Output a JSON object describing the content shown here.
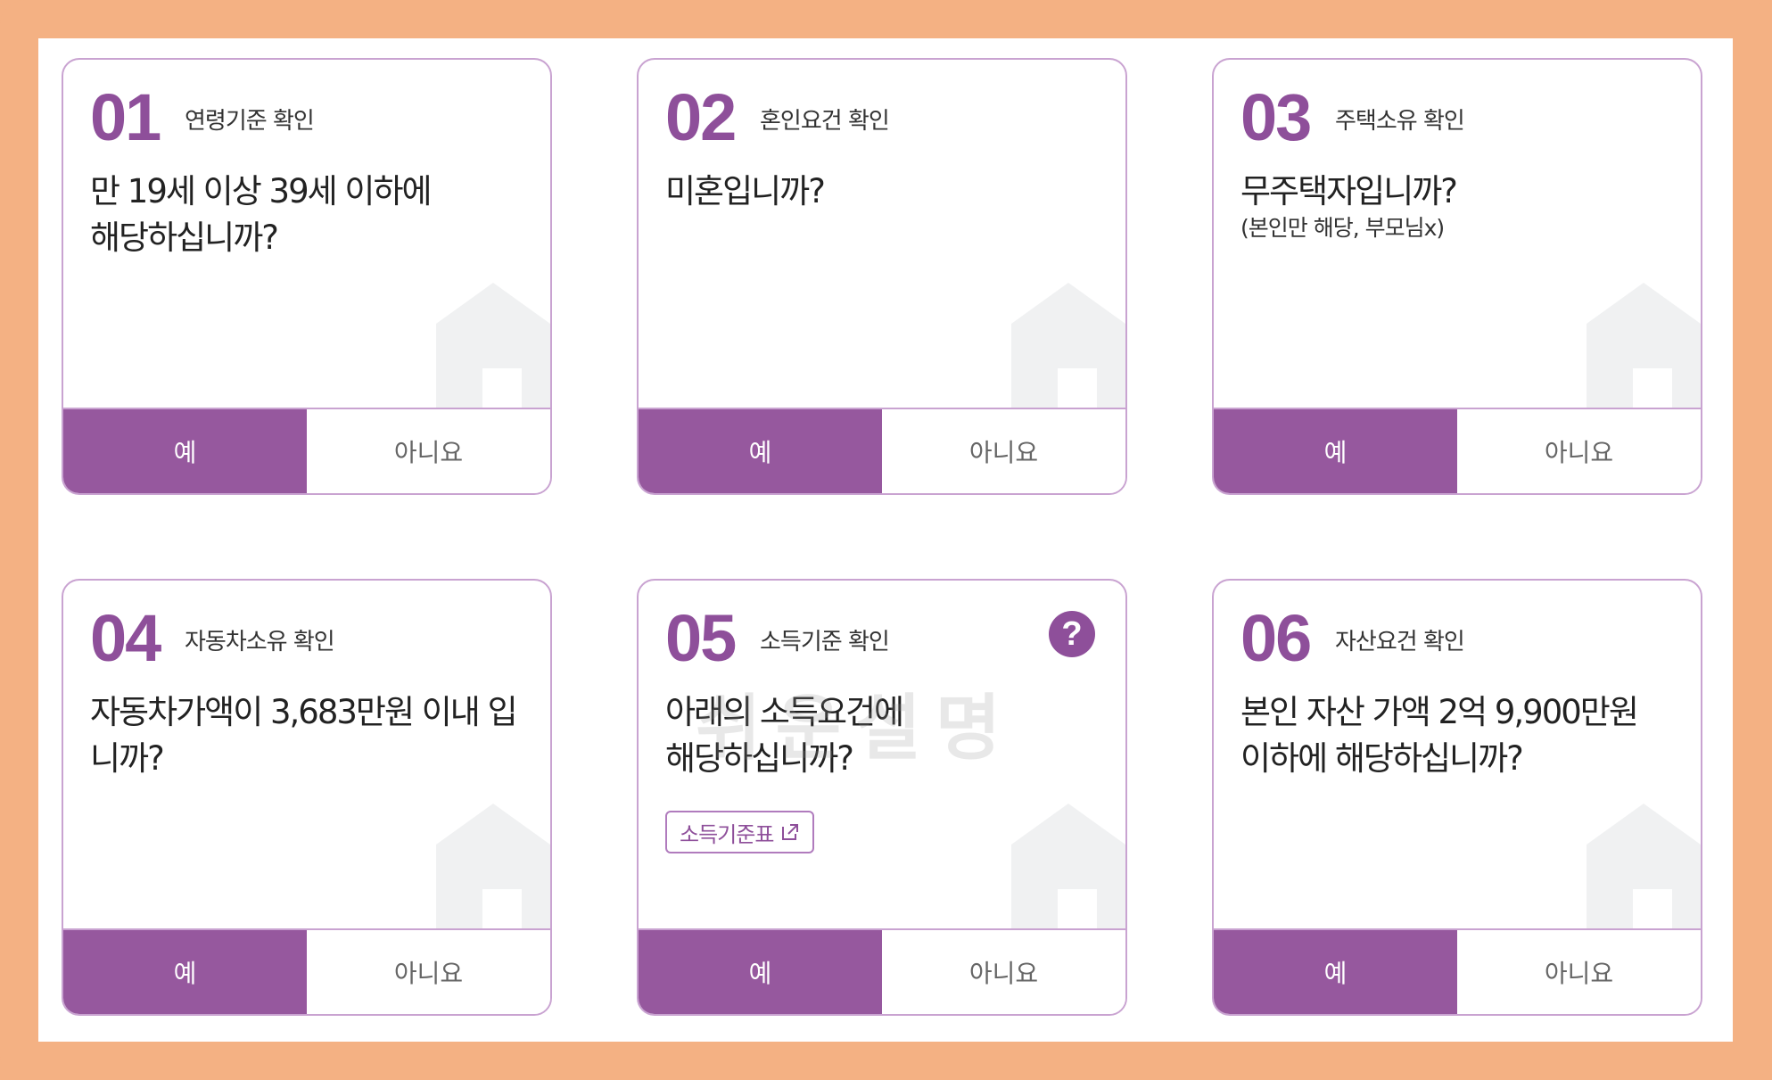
{
  "colors": {
    "accent": "#96589e",
    "number": "#8e4f9a",
    "frame": "#f4b183",
    "border": "#c9a3d1"
  },
  "watermark": "쉬운설명",
  "cards": [
    {
      "num": "01",
      "category": "연령기준 확인",
      "question": "만 19세 이상 39세 이하에\n해당하십니까?",
      "note": "",
      "yes": "예",
      "no": "아니요"
    },
    {
      "num": "02",
      "category": "혼인요건 확인",
      "question": "미혼입니까?",
      "note": "",
      "yes": "예",
      "no": "아니요"
    },
    {
      "num": "03",
      "category": "주택소유 확인",
      "question": "무주택자입니까?",
      "note": "(본인만 해당, 부모님x)",
      "yes": "예",
      "no": "아니요"
    },
    {
      "num": "04",
      "category": "자동차소유 확인",
      "question": "자동차가액이 3,683만원 이내 입\n니까?",
      "note": "",
      "yes": "예",
      "no": "아니요"
    },
    {
      "num": "05",
      "category": "소득기준 확인",
      "question": "아래의 소득요건에\n해당하십니까?",
      "note": "",
      "link_label": "소득기준표",
      "help_icon": "question-circle-icon",
      "yes": "예",
      "no": "아니요"
    },
    {
      "num": "06",
      "category": "자산요건 확인",
      "question": "본인 자산 가액 2억 9,900만원\n이하에 해당하십니까?",
      "note": "",
      "yes": "예",
      "no": "아니요"
    }
  ]
}
